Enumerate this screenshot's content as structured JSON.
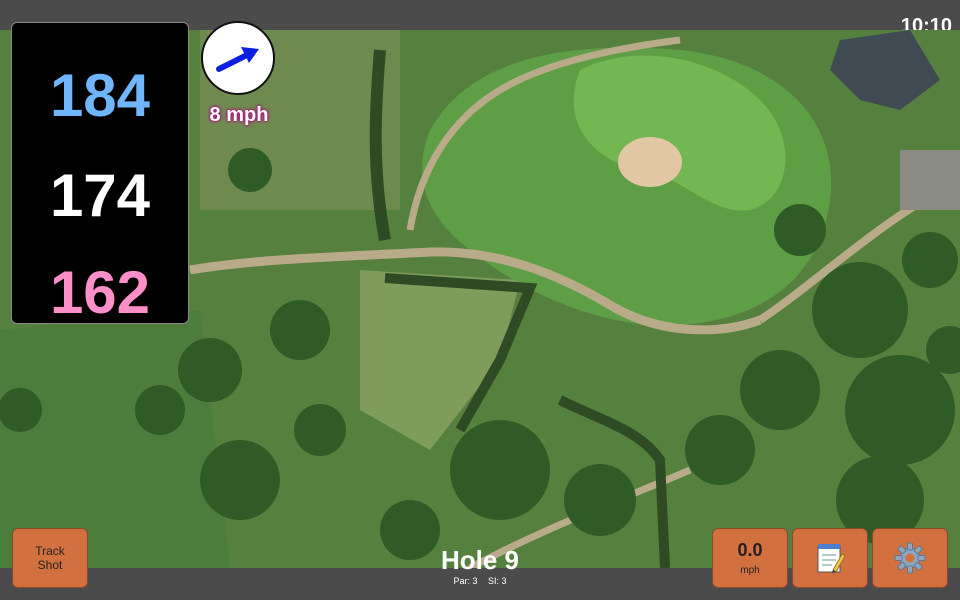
{
  "status": {
    "time": "10:10"
  },
  "distances": {
    "back": "184",
    "center": "174",
    "front": "162"
  },
  "wind": {
    "speed_label": "8 mph",
    "arrow_icon": "wind-direction-arrow-icon",
    "arrow_color": "#0a1fe0"
  },
  "hole": {
    "title": "Hole 9",
    "par_label": "Par: 3",
    "si_label": "SI: 3"
  },
  "buttons": {
    "track_shot_line1": "Track",
    "track_shot_line2": "Shot",
    "wind_value": "0.0",
    "wind_unit": "mph",
    "notes_icon": "notepad-icon",
    "settings_icon": "gear-icon"
  },
  "colors": {
    "button_bg": "#d2703f",
    "back_distance": "#6fb6ff",
    "front_distance": "#ff8fc8"
  }
}
